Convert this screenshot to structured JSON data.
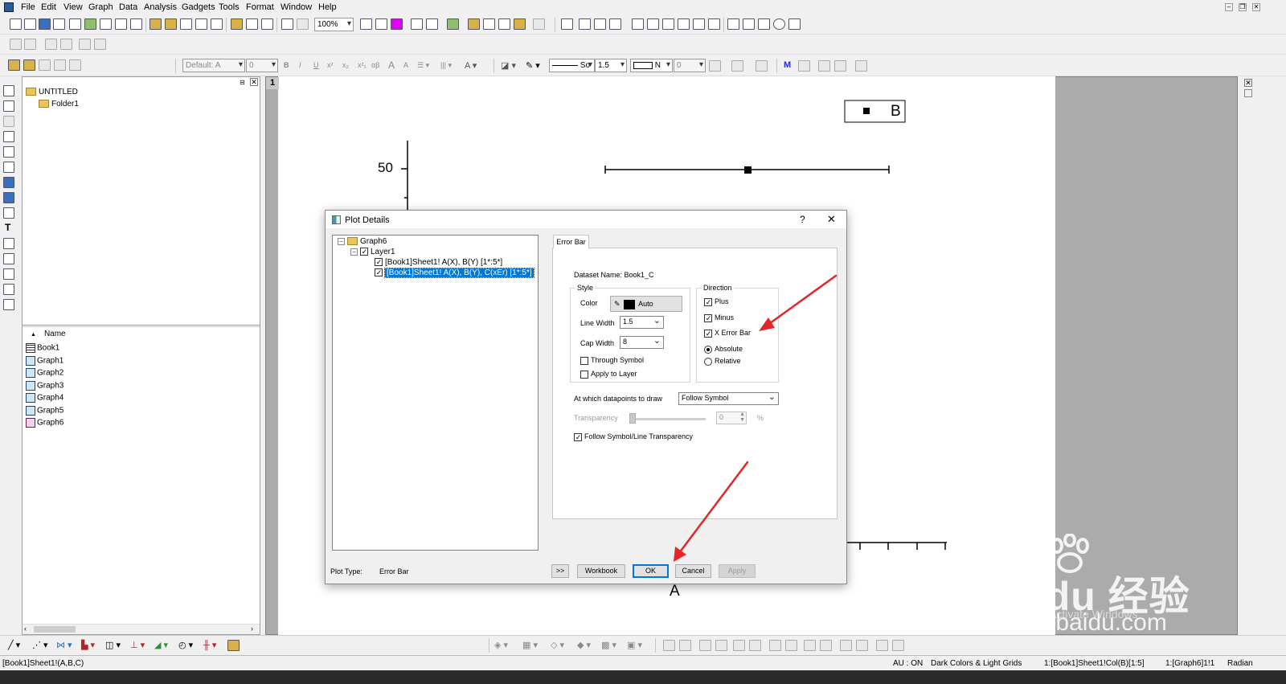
{
  "menu": [
    "File",
    "Edit",
    "View",
    "Graph",
    "Data",
    "Analysis",
    "Gadgets",
    "Tools",
    "Format",
    "Window",
    "Help"
  ],
  "toolbar": {
    "zoom": "100%",
    "font_name": "Default: A",
    "font_size": "0",
    "line_style": "So",
    "line_width": "1.5",
    "fill_label": "N",
    "fill_value": "0"
  },
  "explorer": {
    "root": "UNTITLED",
    "folder": "Folder1",
    "name_header": "Name",
    "items": [
      "Book1",
      "Graph1",
      "Graph2",
      "Graph3",
      "Graph4",
      "Graph5",
      "Graph6"
    ]
  },
  "graph": {
    "page_number": "1",
    "legend_label": "B",
    "y_tick": "50",
    "x_axis_label": "A"
  },
  "dialog": {
    "title": "Plot Details",
    "help": "?",
    "close": "✕",
    "tree": {
      "graph": "Graph6",
      "layer": "Layer1",
      "plot1": "[Book1]Sheet1! A(X), B(Y) [1*:5*]",
      "plot2": "[Book1]Sheet1! A(X), B(Y), C(xEr) [1*:5*]"
    },
    "tab": "Error Bar",
    "dataset_name": "Dataset Name: Book1_C",
    "style": {
      "legend": "Style",
      "color_label": "Color",
      "color_value": "Auto",
      "line_width_label": "Line Width",
      "line_width": "1.5",
      "cap_width_label": "Cap Width",
      "cap_width": "8",
      "through_symbol": "Through Symbol",
      "apply_to_layer": "Apply to Layer"
    },
    "direction": {
      "legend": "Direction",
      "plus": "Plus",
      "minus": "Minus",
      "x_error_bar": "X Error Bar",
      "absolute": "Absolute",
      "relative": "Relative"
    },
    "draw_at_label": "At which datapoints to draw",
    "draw_at_value": "Follow Symbol",
    "transparency_label": "Transparency",
    "transparency_value": "0",
    "percent": "%",
    "follow_transparency": "Follow Symbol/Line Transparency",
    "plot_type_label": "Plot Type:",
    "plot_type_value": "Error Bar",
    "buttons": {
      "more": ">>",
      "workbook": "Workbook",
      "ok": "OK",
      "cancel": "Cancel",
      "apply": "Apply"
    }
  },
  "status": {
    "left": "[Book1]Sheet1!(A,B,C)",
    "au": "AU : ON",
    "theme": "Dark Colors & Light Grids",
    "col": "1:[Book1]Sheet1!Col(B)[1:5]",
    "graph": "1:[Graph6]1!1",
    "angle": "Radian"
  },
  "watermark": {
    "logo": "Bai du 经验",
    "site": "jingyan.baidu.com",
    "activate": "Activate Windows"
  }
}
